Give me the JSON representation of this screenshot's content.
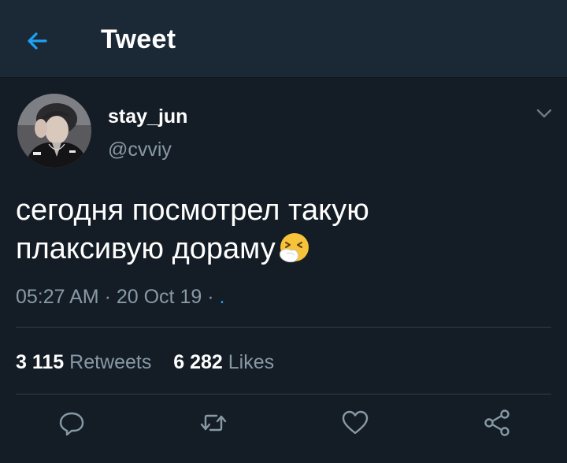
{
  "header": {
    "title": "Tweet",
    "back_icon": "arrow-left-icon"
  },
  "tweet": {
    "user_name": "stay_jun",
    "user_handle": "@cvviy",
    "text_line1": "сегодня посмотрел такую",
    "text_line2": "плаксивую дораму",
    "emoji": "sneezing-face-emoji",
    "time": "05:27 AM",
    "sep1": " · ",
    "date": "20 Oct 19",
    "sep2": " · ",
    "source_link": "."
  },
  "stats": {
    "retweets_count": "3 115",
    "retweets_label": "Retweets",
    "likes_count": "6 282",
    "likes_label": "Likes"
  },
  "actions": [
    "reply-icon",
    "retweet-icon",
    "like-icon",
    "share-icon"
  ],
  "colors": {
    "background": "#141d26",
    "header_background": "#1b2836",
    "accent": "#1da1f2",
    "secondary_text": "#8899a6",
    "divider": "#2f3d4b"
  }
}
